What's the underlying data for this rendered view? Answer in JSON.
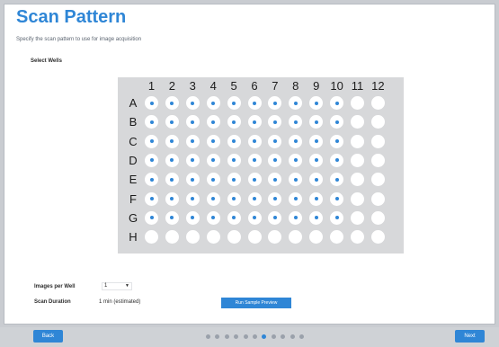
{
  "header": {
    "title": "Scan Pattern",
    "subtitle": "Specify the scan pattern to use for image acquisition"
  },
  "plate": {
    "section_label": "Select Wells",
    "columns": [
      "1",
      "2",
      "3",
      "4",
      "5",
      "6",
      "7",
      "8",
      "9",
      "10",
      "11",
      "12"
    ],
    "rows": [
      "A",
      "B",
      "C",
      "D",
      "E",
      "F",
      "G",
      "H"
    ],
    "selected_rows": 7,
    "selected_columns": 10,
    "accent_color": "#2f86d6"
  },
  "settings": {
    "images_per_well_label": "Images per Well",
    "images_per_well_value": "1",
    "scan_duration_label": "Scan Duration",
    "scan_duration_value": "1 min (estimated)",
    "sample_button_label": "Run Sample Preview"
  },
  "navigation": {
    "back_label": "Back",
    "next_label": "Next",
    "page_count": 11,
    "current_page": 7
  }
}
